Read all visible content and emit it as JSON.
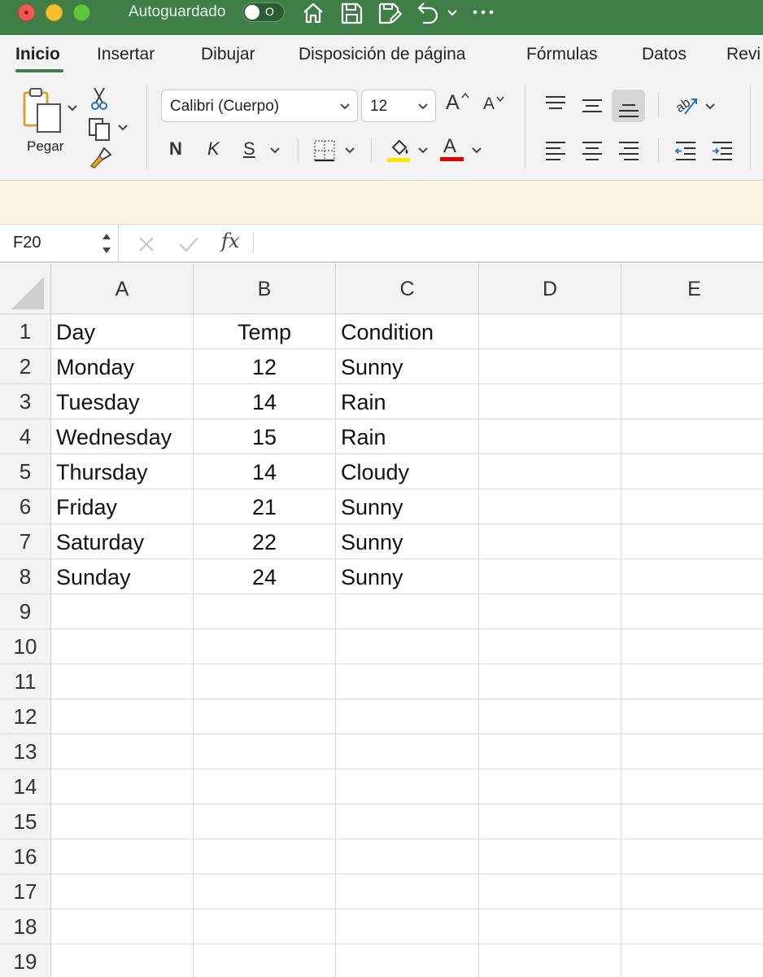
{
  "titlebar": {
    "autosave_label": "Autoguardado",
    "autosave_state": "O",
    "quick_access": [
      "home-icon",
      "save-icon",
      "save-edit-icon",
      "undo-icon",
      "more-icon"
    ]
  },
  "tabs": [
    {
      "label": "Inicio",
      "active": true
    },
    {
      "label": "Insertar"
    },
    {
      "label": "Dibujar"
    },
    {
      "label": "Disposición de página"
    },
    {
      "label": "Fórmulas"
    },
    {
      "label": "Datos"
    },
    {
      "label": "Revi"
    }
  ],
  "ribbon": {
    "paste_label": "Pegar",
    "font_name": "Calibri (Cuerpo)",
    "font_size": "12",
    "bold_label": "N",
    "italic_label": "K",
    "underline_label": "S",
    "grow_font_label": "A",
    "shrink_font_label": "A",
    "font_color_label": "A",
    "highlight_color": "#ffe600",
    "font_color": "#e00000"
  },
  "formula_bar": {
    "name_box": "F20",
    "fx_label": "fx",
    "formula": ""
  },
  "sheet": {
    "columns": [
      "A",
      "B",
      "C",
      "D",
      "E"
    ],
    "row_numbers": [
      "1",
      "2",
      "3",
      "4",
      "5",
      "6",
      "7",
      "8",
      "9",
      "10",
      "11",
      "12",
      "13",
      "14",
      "15",
      "16",
      "17",
      "18",
      "19"
    ],
    "rows": [
      [
        "Day",
        "Temp",
        "Condition",
        "",
        ""
      ],
      [
        "Monday",
        "12",
        "Sunny",
        "",
        ""
      ],
      [
        "Tuesday",
        "14",
        "Rain",
        "",
        ""
      ],
      [
        "Wednesday",
        "15",
        "Rain",
        "",
        ""
      ],
      [
        "Thursday",
        "14",
        "Cloudy",
        "",
        ""
      ],
      [
        "Friday",
        "21",
        "Sunny",
        "",
        ""
      ],
      [
        "Saturday",
        "22",
        "Sunny",
        "",
        ""
      ],
      [
        "Sunday",
        "24",
        "Sunny",
        "",
        ""
      ]
    ]
  },
  "colors": {
    "title_green": "#3f7e47",
    "ribbon_bg": "#f3f3f3",
    "message_bar": "#fbf3df"
  }
}
